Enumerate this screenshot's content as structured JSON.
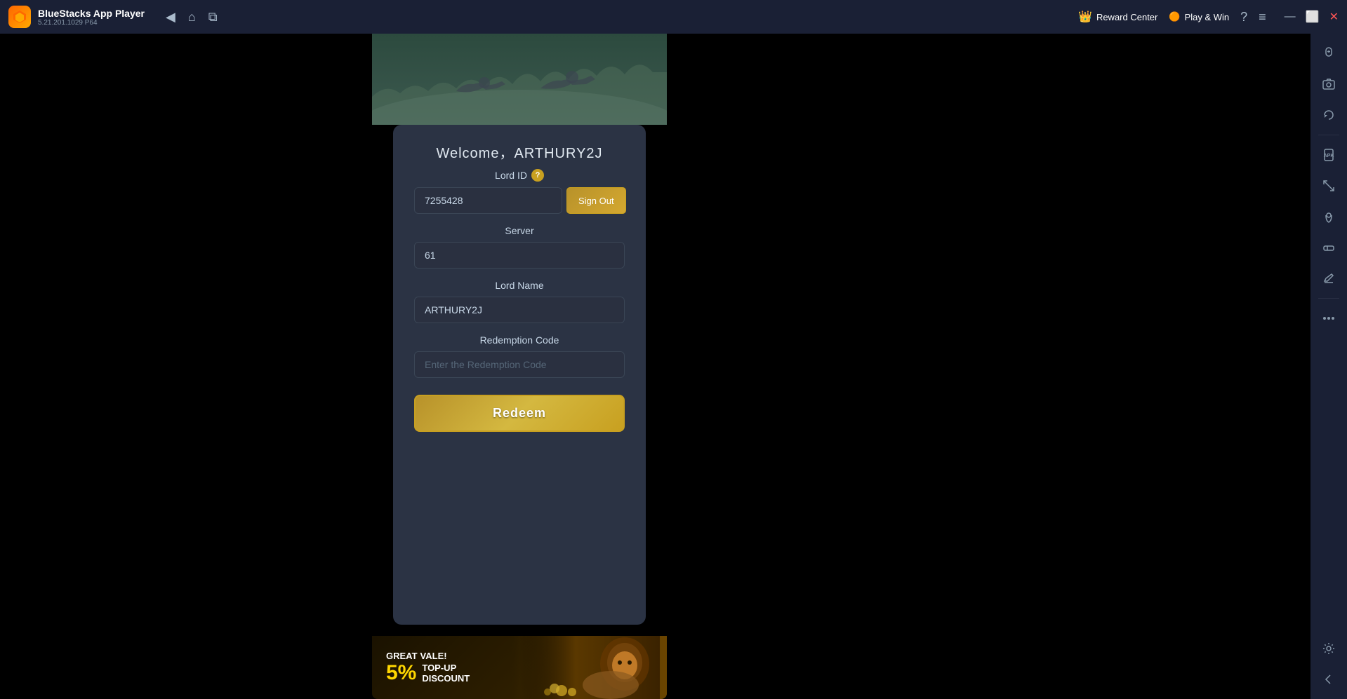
{
  "titlebar": {
    "app_name": "BlueStacks App Player",
    "app_version": "5.21.201.1029  P64",
    "back_icon": "◀",
    "home_icon": "⌂",
    "tab_icon": "⧉",
    "reward_center_label": "Reward Center",
    "reward_icon": "👑",
    "play_win_label": "Play & Win",
    "play_win_icon": "🟠",
    "help_icon": "?",
    "menu_icon": "≡",
    "minimize_icon": "—",
    "maximize_icon": "⬜",
    "close_icon": "✕"
  },
  "game": {
    "welcome_text": "Welcome，ARTHURY2J",
    "lord_id_label": "Lord ID",
    "lord_id_help": "?",
    "lord_id_value": "7255428",
    "sign_out_label": "Sign Out",
    "server_label": "Server",
    "server_value": "61",
    "lord_name_label": "Lord Name",
    "lord_name_value": "ARTHURY2J",
    "redemption_code_label": "Redemption Code",
    "redemption_code_placeholder": "Enter the Redemption Code",
    "redeem_label": "Redeem",
    "banner_great": "GREAT",
    "banner_value": "5%",
    "banner_topup": "TOP-UP",
    "banner_discount": "DISCOUNT",
    "banner_value_prefix": "VALE!"
  },
  "sidebar": {
    "icons": [
      {
        "name": "sidebar-gear-icon",
        "symbol": "⚙"
      },
      {
        "name": "sidebar-mouse-icon",
        "symbol": "🖱"
      },
      {
        "name": "sidebar-camera-icon",
        "symbol": "📷"
      },
      {
        "name": "sidebar-rotate-icon",
        "symbol": "↺"
      },
      {
        "name": "sidebar-apk-icon",
        "symbol": "📦"
      },
      {
        "name": "sidebar-resize-icon",
        "symbol": "⤢"
      },
      {
        "name": "sidebar-pin-icon",
        "symbol": "📌"
      },
      {
        "name": "sidebar-erase-icon",
        "symbol": "⌦"
      },
      {
        "name": "sidebar-more-icon",
        "symbol": "…"
      },
      {
        "name": "sidebar-settings-icon",
        "symbol": "⚙"
      },
      {
        "name": "sidebar-back-icon",
        "symbol": "↩"
      }
    ]
  }
}
